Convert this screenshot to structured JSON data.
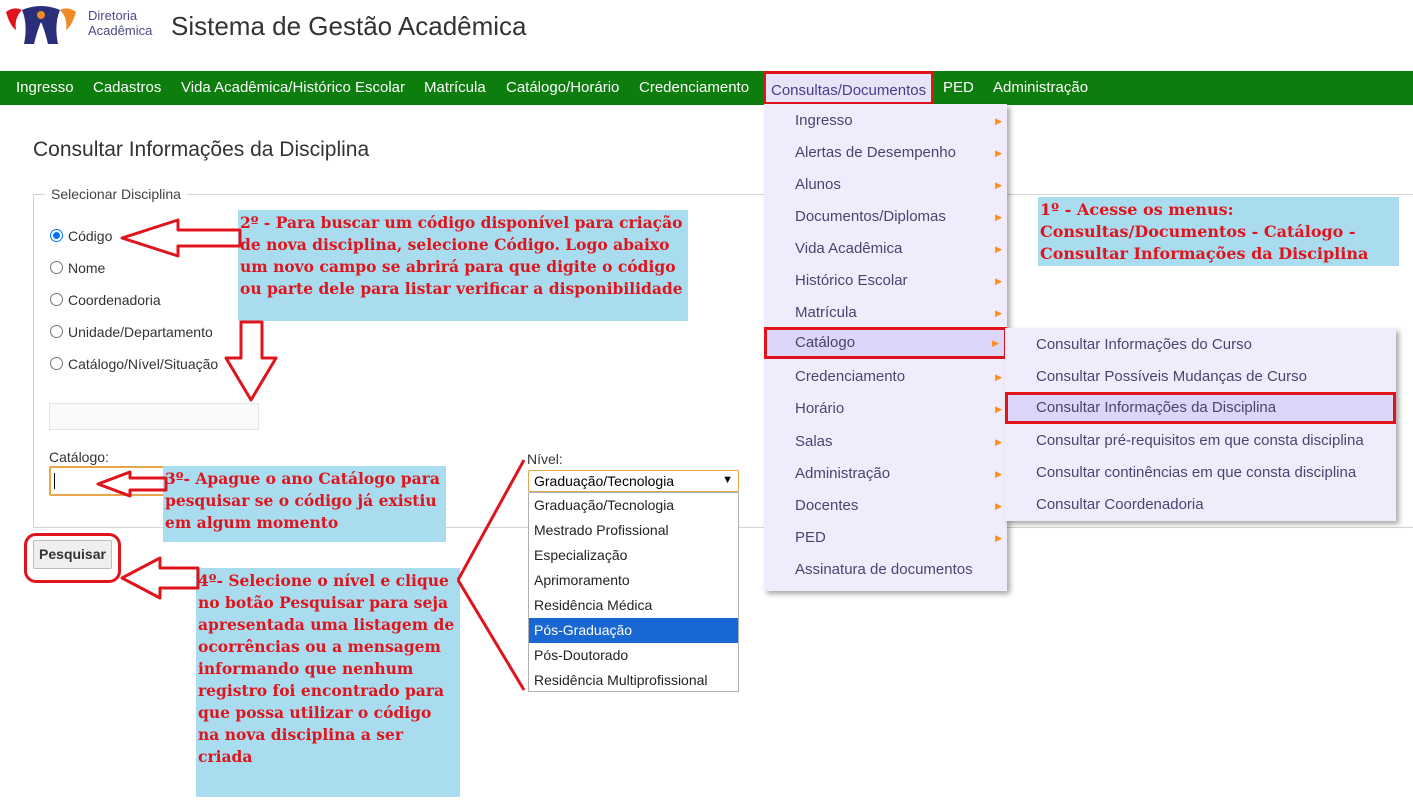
{
  "header": {
    "logo_line1": "Diretoria",
    "logo_line2": "Acadêmica",
    "title": "Sistema de Gestão Acadêmica"
  },
  "nav": {
    "items": [
      "Ingresso",
      "Cadastros",
      "Vida Acadêmica/Histórico Escolar",
      "Matrícula",
      "Catálogo/Horário",
      "Credenciamento",
      "Consultas/Documentos",
      "PED",
      "Administração"
    ]
  },
  "page": {
    "title": "Consultar Informações da Disciplina",
    "legend": "Selecionar Disciplina",
    "radios": [
      "Código",
      "Nome",
      "Coordenadoria",
      "Unidade/Departamento",
      "Catálogo/Nível/Situação"
    ],
    "selected_radio": "Código",
    "catalogo_label": "Catálogo:",
    "catalogo_value": "",
    "nivel_label": "Nível:",
    "nivel_selected": "Graduação/Tecnologia",
    "nivel_options": [
      "Graduação/Tecnologia",
      "Mestrado Profissional",
      "Especialização",
      "Aprimoramento",
      "Residência Médica",
      "Pós-Graduação",
      "Pós-Doutorado",
      "Residência Multiprofissional"
    ],
    "nivel_highlighted": "Pós-Graduação",
    "search_button": "Pesquisar"
  },
  "menu": {
    "items": [
      "Ingresso",
      "Alertas de Desempenho",
      "Alunos",
      "Documentos/Diplomas",
      "Vida Acadêmica",
      "Histórico Escolar",
      "Matrícula",
      "Catálogo",
      "Credenciamento",
      "Horário",
      "Salas",
      "Administração",
      "Docentes",
      "PED",
      "Assinatura de documentos"
    ],
    "submenu": [
      "Consultar Informações do Curso",
      "Consultar Possíveis Mudanças de Curso",
      "Consultar Informações da Disciplina",
      "Consultar pré-requisitos em que consta disciplina",
      "Consultar continências em que consta disciplina",
      "Consultar Coordenadoria"
    ]
  },
  "annotations": {
    "step1": "1º - Acesse os menus: Consultas/Documentos - Catálogo - Consultar Informações da Disciplina",
    "step2": "2º - Para buscar um código disponível para criação de nova disciplina, selecione Código. Logo abaixo um novo campo se abrirá para que digite o código ou parte dele para listar verificar a disponibilidade",
    "step3": "3º- Apague o ano Catálogo para pesquisar se o código já existiu em algum momento",
    "step4": "4º- Selecione o nível e clique no botão Pesquisar para seja apresentada uma listagem de ocorrências ou a mensagem informando que nenhum registro foi encontrado para que possa utilizar o código na nova disciplina a ser criada"
  },
  "colors": {
    "nav_bg": "#0d7d0d",
    "menu_bg": "#efedfc",
    "highlight_border": "#e0141c",
    "note_bg": "#a9dcee",
    "note_text": "#e0141c"
  }
}
